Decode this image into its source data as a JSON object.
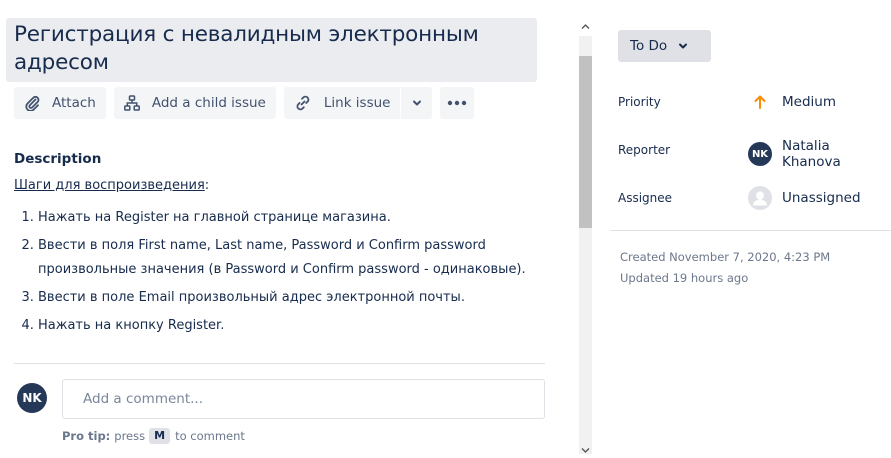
{
  "issue": {
    "title": "Регистрация с невалидным электронным адресом"
  },
  "toolbar": {
    "attach_label": "Attach",
    "child_issue_label": "Add a child issue",
    "link_issue_label": "Link issue"
  },
  "description": {
    "heading": "Description",
    "steps_title": "Шаги для воспроизведения",
    "steps_suffix": ":",
    "steps": [
      "Нажать на Register на главной странице магазина.",
      "Ввести в поля First name, Last name, Password и Confirm password произвольные значения (в Password и Confirm password - одинаковые).",
      "Ввести в поле Email произвольный адрес электронной почты.",
      "Нажать на кнопку Register."
    ]
  },
  "comment": {
    "avatar_initials": "NK",
    "placeholder": "Add a comment...",
    "pro_tip_label": "Pro tip:",
    "pro_tip_press": "press",
    "pro_tip_key": "M",
    "pro_tip_suffix": "to comment"
  },
  "sidebar": {
    "status": "To Do",
    "priority_label": "Priority",
    "priority_value": "Medium",
    "reporter_label": "Reporter",
    "reporter_initials": "NK",
    "reporter_name": "Natalia Khanova",
    "assignee_label": "Assignee",
    "assignee_value": "Unassigned",
    "created": "Created November 7, 2020, 4:23 PM",
    "updated": "Updated 19 hours ago"
  },
  "colors": {
    "priority_medium": "#FF8B00",
    "avatar_bg": "#253858",
    "title_bg": "#EBECF0"
  },
  "icons": {
    "attach": "paperclip-icon",
    "child_issue": "hierarchy-icon",
    "link_issue": "link-icon",
    "more": "more-dots-icon",
    "status_dropdown": "chevron-down-icon",
    "priority": "arrow-up-icon",
    "assignee": "person-icon"
  }
}
